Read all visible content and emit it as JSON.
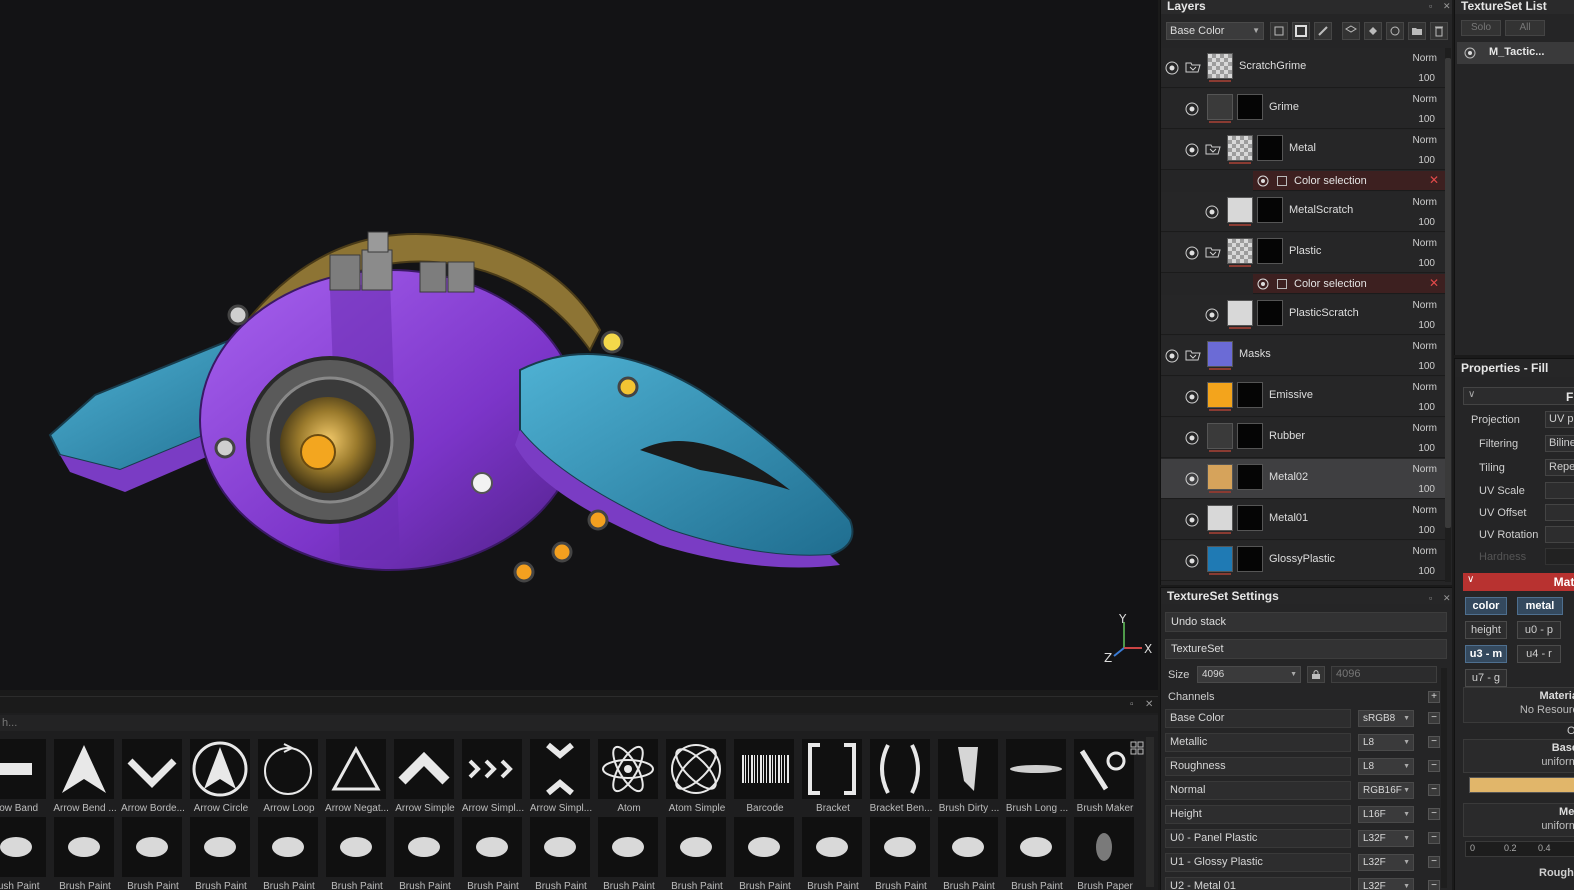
{
  "viewport": {
    "gizmo": {
      "x": "X",
      "y": "Y",
      "z": "Z"
    }
  },
  "shelf": {
    "search_text": "h...",
    "row1": [
      {
        "label": "row Band",
        "icon": "band-icon"
      },
      {
        "label": "Arrow Bend ...",
        "icon": "arrow-bend-icon"
      },
      {
        "label": "Arrow Borde...",
        "icon": "arrow-border-icon"
      },
      {
        "label": "Arrow Circle",
        "icon": "arrow-circle-icon"
      },
      {
        "label": "Arrow Loop",
        "icon": "arrow-loop-icon"
      },
      {
        "label": "Arrow Negat...",
        "icon": "arrow-negative-icon"
      },
      {
        "label": "Arrow Simple",
        "icon": "arrow-simple-icon"
      },
      {
        "label": "Arrow Simpl...",
        "icon": "arrow-simple-triple-icon"
      },
      {
        "label": "Arrow Simpl...",
        "icon": "arrow-simple-double-icon"
      },
      {
        "label": "Atom",
        "icon": "atom-icon"
      },
      {
        "label": "Atom Simple",
        "icon": "atom-simple-icon"
      },
      {
        "label": "Barcode",
        "icon": "barcode-icon"
      },
      {
        "label": "Bracket",
        "icon": "bracket-icon"
      },
      {
        "label": "Bracket Ben...",
        "icon": "bracket-bend-icon"
      },
      {
        "label": "Brush Dirty ...",
        "icon": "brush-dirty-icon"
      },
      {
        "label": "Brush Long ...",
        "icon": "brush-long-icon"
      },
      {
        "label": "Brush Maker",
        "icon": "brush-maker-icon"
      }
    ],
    "row2": [
      {
        "label": "rush Paint",
        "icon": "brush-paint-icon"
      },
      {
        "label": "Brush Paint",
        "icon": "brush-paint-icon"
      },
      {
        "label": "Brush Paint",
        "icon": "brush-paint-icon"
      },
      {
        "label": "Brush Paint",
        "icon": "brush-paint-icon"
      },
      {
        "label": "Brush Paint",
        "icon": "brush-paint-icon"
      },
      {
        "label": "Brush Paint",
        "icon": "brush-paint-icon"
      },
      {
        "label": "Brush Paint",
        "icon": "brush-paint-icon"
      },
      {
        "label": "Brush Paint",
        "icon": "brush-paint-icon"
      },
      {
        "label": "Brush Paint",
        "icon": "brush-paint-icon"
      },
      {
        "label": "Brush Paint",
        "icon": "brush-paint-icon"
      },
      {
        "label": "Brush Paint",
        "icon": "brush-paint-icon"
      },
      {
        "label": "Brush Paint",
        "icon": "brush-paint-icon"
      },
      {
        "label": "Brush Paint",
        "icon": "brush-paint-icon"
      },
      {
        "label": "Brush Paint",
        "icon": "brush-paint-icon"
      },
      {
        "label": "Brush Paint",
        "icon": "brush-paint-icon"
      },
      {
        "label": "Brush Paint",
        "icon": "brush-paint-icon"
      },
      {
        "label": "Brush Paper",
        "icon": "brush-paper-icon"
      }
    ]
  },
  "layers": {
    "title": "Layers",
    "channel": "Base Color",
    "items": [
      {
        "name": "ScratchGrime",
        "blend": "Norm",
        "opacity": "100",
        "type": "folder",
        "level": 0
      },
      {
        "name": "Grime",
        "blend": "Norm",
        "opacity": "100",
        "type": "fill",
        "level": 1
      },
      {
        "name": "Metal",
        "blend": "Norm",
        "opacity": "100",
        "type": "folder",
        "level": 1
      },
      {
        "name": "Color selection",
        "type": "effect"
      },
      {
        "name": "MetalScratch",
        "blend": "Norm",
        "opacity": "100",
        "type": "fill",
        "level": 2
      },
      {
        "name": "Plastic",
        "blend": "Norm",
        "opacity": "100",
        "type": "folder",
        "level": 1
      },
      {
        "name": "Color selection",
        "type": "effect"
      },
      {
        "name": "PlasticScratch",
        "blend": "Norm",
        "opacity": "100",
        "type": "fill",
        "level": 2
      },
      {
        "name": "Masks",
        "blend": "Norm",
        "opacity": "100",
        "type": "folder",
        "level": 0
      },
      {
        "name": "Emissive",
        "blend": "Norm",
        "opacity": "100",
        "type": "fill",
        "level": 1
      },
      {
        "name": "Rubber",
        "blend": "Norm",
        "opacity": "100",
        "type": "fill",
        "level": 1
      },
      {
        "name": "Metal02",
        "blend": "Norm",
        "opacity": "100",
        "type": "fill",
        "level": 1
      },
      {
        "name": "Metal01",
        "blend": "Norm",
        "opacity": "100",
        "type": "fill",
        "level": 1
      },
      {
        "name": "GlossyPlastic",
        "blend": "Norm",
        "opacity": "100",
        "type": "fill",
        "level": 1
      }
    ]
  },
  "texture_set_settings": {
    "title": "TextureSet Settings",
    "undo_stack": "Undo stack",
    "texture_set": "TextureSet",
    "size_label": "Size",
    "size_value": "4096",
    "size_value2": "4096",
    "channels_label": "Channels",
    "channels": [
      {
        "name": "Base Color",
        "format": "sRGB8"
      },
      {
        "name": "Metallic",
        "format": "L8"
      },
      {
        "name": "Roughness",
        "format": "L8"
      },
      {
        "name": "Normal",
        "format": "RGB16F"
      },
      {
        "name": "Height",
        "format": "L16F"
      },
      {
        "name": "U0 - Panel Plastic",
        "format": "L32F"
      },
      {
        "name": "U1 - Glossy Plastic",
        "format": "L32F"
      },
      {
        "name": "U2 - Metal 01",
        "format": "L32F"
      }
    ]
  },
  "texture_set_list": {
    "title": "TextureSet List",
    "solo_label": "Solo",
    "all_label": "All",
    "item_name": "M_Tactic..."
  },
  "properties": {
    "title": "Properties - Fill",
    "fill_header": "Fil",
    "projection_label": "Projection",
    "projection_value": "UV proje",
    "filtering_label": "Filtering",
    "filtering_value": "Biline",
    "tiling_label": "Tiling",
    "tiling_value": "Repe",
    "uv_scale_label": "UV Scale",
    "uv_offset_label": "UV Offset",
    "uv_rotation_label": "UV Rotation",
    "hardness_label": "Hardness",
    "material_header": "Mate",
    "chips": [
      "color",
      "metal",
      "height",
      "u0 - p",
      "u3 - m",
      "u4 - r",
      "u7 - g"
    ],
    "material_box_title": "Materia",
    "material_box_sub": "No Resourc",
    "material_box_extra": "O",
    "base_title": "Base",
    "base_sub": "uniform",
    "metal_title": "Met",
    "metal_sub": "uniform",
    "rough_title": "Rough",
    "slider_ticks": [
      "0",
      "0.2",
      "0.4"
    ],
    "base_color_swatch": "#e1b66a"
  },
  "colors": {
    "accent_red": "#b83230",
    "ship_purple": "#8a3fd6",
    "ship_teal": "#2e8fb3",
    "ship_gold": "#b6953c"
  }
}
